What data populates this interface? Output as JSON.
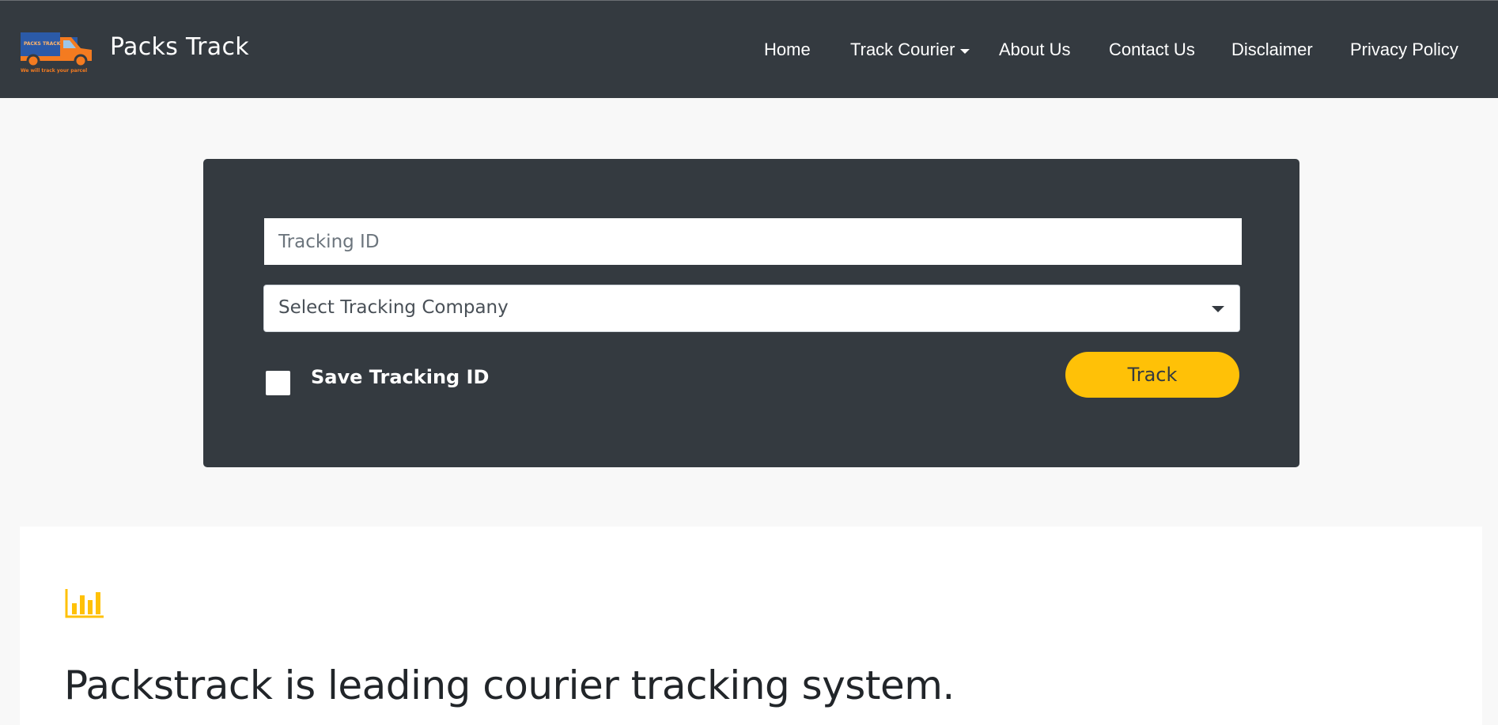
{
  "header": {
    "logo_icon": "delivery-truck-logo",
    "logo_badge_text": "PACKS TRACK",
    "logo_tagline": "We will track your parcel",
    "brand_name": "Packs Track",
    "nav": {
      "home": "Home",
      "track_courier": "Track Courier",
      "about_us": "About Us",
      "contact_us": "Contact Us",
      "disclaimer": "Disclaimer",
      "privacy_policy": "Privacy Policy"
    }
  },
  "tracking_form": {
    "tracking_id_value": "",
    "tracking_id_placeholder": "Tracking ID",
    "company_select_value": "Select Tracking Company",
    "save_checkbox_checked": false,
    "save_label": "Save Tracking ID",
    "track_button_label": "Track"
  },
  "info": {
    "icon": "bar-chart-icon",
    "headline": "Packstrack is leading courier tracking system."
  },
  "colors": {
    "navbar_bg": "#343a40",
    "card_bg": "#343a40",
    "accent": "#ffc107",
    "logo_orange": "#f47b20",
    "logo_blue": "#2b5aa8",
    "page_bg": "#f8f8f8"
  }
}
